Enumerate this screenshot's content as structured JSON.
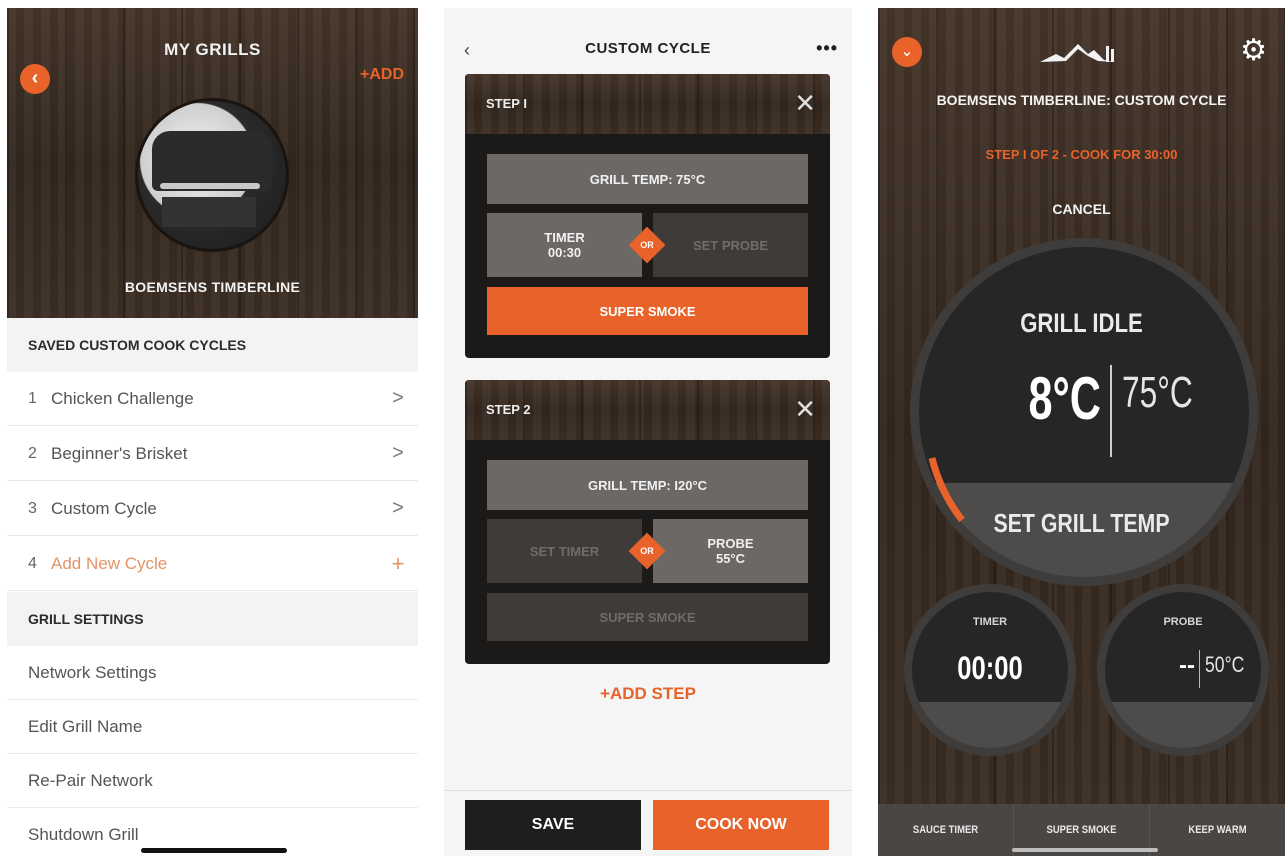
{
  "panel1": {
    "header_title": "MY GRILLS",
    "back_icon": "chevron-left-icon",
    "add_label": "+ADD",
    "grill_name": "BOEMSENS TIMBERLINE",
    "saved_section": "SAVED CUSTOM COOK CYCLES",
    "cycles": [
      {
        "num": "1",
        "label": "Chicken Challenge",
        "icon": ">"
      },
      {
        "num": "2",
        "label": "Beginner's Brisket",
        "icon": ">"
      },
      {
        "num": "3",
        "label": "Custom Cycle",
        "icon": ">"
      },
      {
        "num": "4",
        "label": "Add New Cycle",
        "icon": "+"
      }
    ],
    "settings_section": "GRILL SETTINGS",
    "settings": [
      "Network Settings",
      "Edit Grill Name",
      "Re-Pair Network",
      "Shutdown Grill"
    ]
  },
  "panel2": {
    "title": "CUSTOM CYCLE",
    "back": "‹",
    "more": "•••",
    "step1": {
      "label": "STEP I",
      "close": "✕",
      "grill_temp": "GRILL TEMP: 75°C",
      "timer_label": "TIMER",
      "timer_value": "00:30",
      "diamond": "OR",
      "probe": "SET PROBE",
      "super_smoke": "SUPER SMOKE"
    },
    "step2": {
      "label": "STEP 2",
      "close": "✕",
      "grill_temp": "GRILL TEMP: I20°C",
      "timer": "SET TIMER",
      "diamond": "OR",
      "probe_label": "PROBE",
      "probe_value": "55°C",
      "super_smoke": "SUPER SMOKE"
    },
    "add_step": "+ADD STEP",
    "save": "SAVE",
    "cook_now": "COOK NOW"
  },
  "panel3": {
    "expand_icon": "chevron-down-icon",
    "settings_icon": "gear-icon",
    "title": "BOEMSENS TIMBERLINE: CUSTOM CYCLE",
    "step_text": "STEP I OF 2 - COOK FOR 30:00",
    "cancel": "CANCEL",
    "status": "GRILL IDLE",
    "current_temp": "8°C",
    "target_temp": "75°C",
    "set_grill_temp": "SET GRILL TEMP",
    "timer_caption": "TIMER",
    "timer_value": "00:00",
    "probe_caption": "PROBE",
    "probe_current": "--",
    "probe_target": "50°C",
    "tabs": [
      "SAUCE TIMER",
      "SUPER SMOKE",
      "KEEP WARM"
    ],
    "accent_color": "#e8622a"
  }
}
